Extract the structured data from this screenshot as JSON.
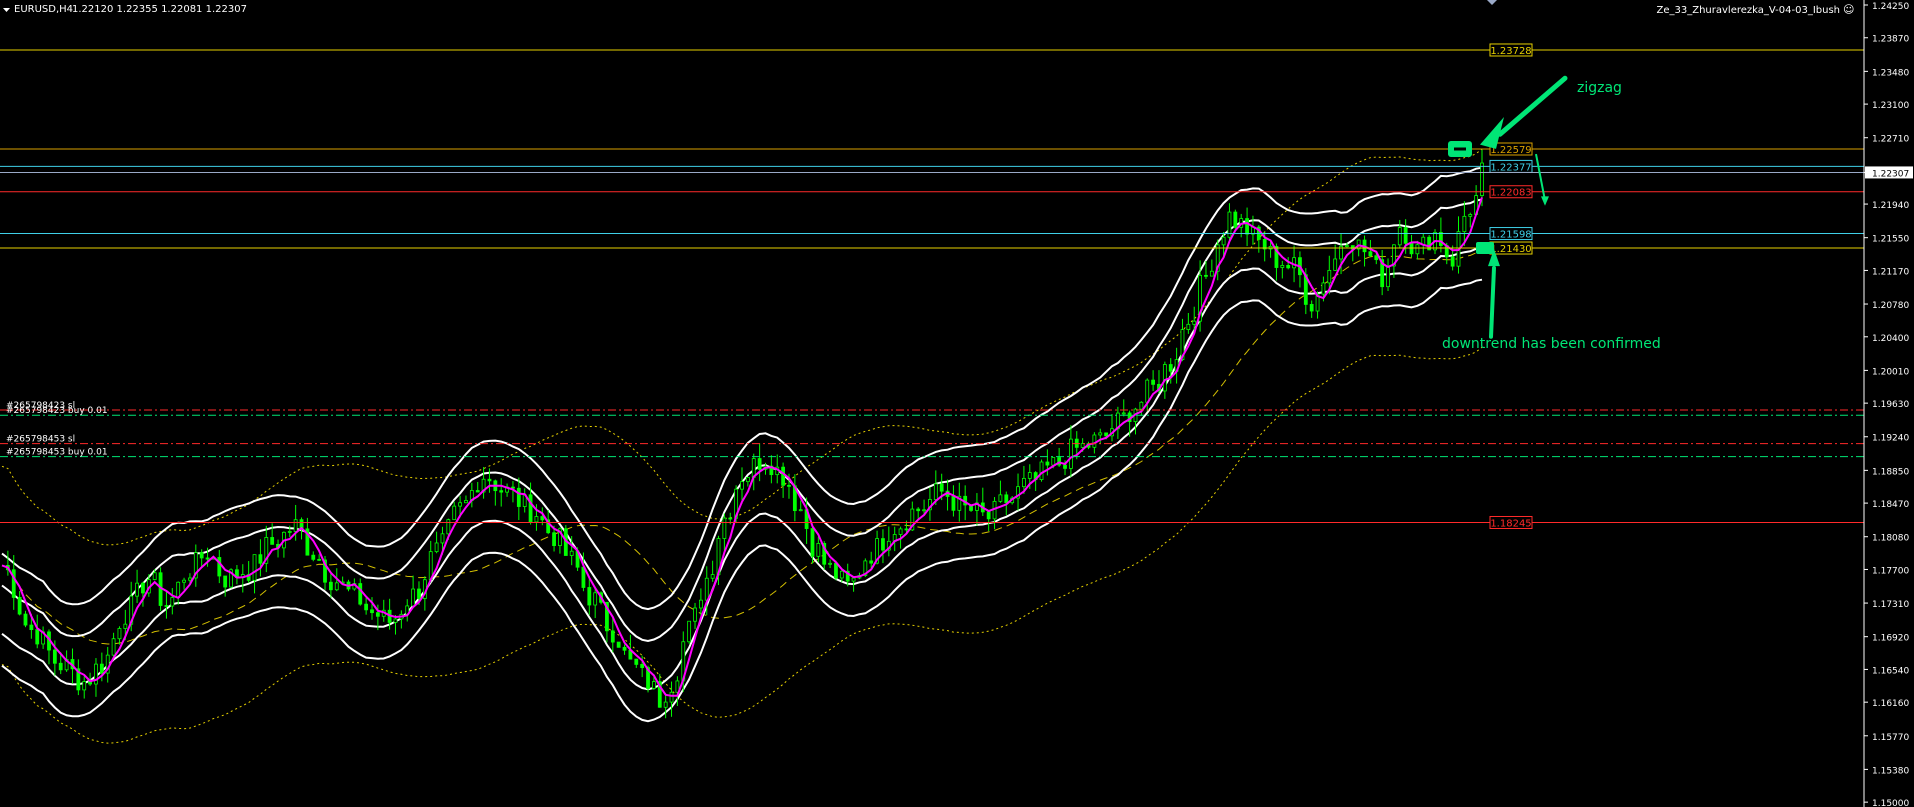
{
  "header": {
    "symbol": "EURUSD,H4",
    "ohlc": "1.22120 1.22355 1.22081 1.22307",
    "indicator_name": "Ze_33_Zhuravlerezka_V-04-03_Ibush",
    "smiley": "☺"
  },
  "colors": {
    "background": "#000000",
    "candle": "#00ff00",
    "band": "#ffffff",
    "ma": "#ff00ff",
    "dotted_band": "#e6d000",
    "dashed_ma": "#d4c000",
    "annotation": "#00e676",
    "axis_text": "#ffffff",
    "grid_text": "#ffffff",
    "orange_line": "#d9a000",
    "yellow_line": "#e6d000",
    "cyan_line": "#3fd0e8",
    "red_line": "#ff2a2a"
  },
  "chart_data": {
    "type": "candlestick",
    "symbol": "EURUSD",
    "timeframe": "H4",
    "ylim": [
      1.1499,
      1.2425
    ],
    "y_ticks": [
      "1.24250",
      "1.23870",
      "1.23480",
      "1.23100",
      "1.22710",
      "1.22307",
      "1.21940",
      "1.21550",
      "1.21170",
      "1.20780",
      "1.20400",
      "1.20010",
      "1.19630",
      "1.19240",
      "1.18850",
      "1.18470",
      "1.18080",
      "1.17700",
      "1.17310",
      "1.16920",
      "1.16540",
      "1.16160",
      "1.15770",
      "1.15380",
      "1.15000"
    ],
    "current_price": "1.22307",
    "path": [
      [
        0,
        1.1775
      ],
      [
        5,
        1.17
      ],
      [
        10,
        1.166
      ],
      [
        14,
        1.164
      ],
      [
        17,
        1.166
      ],
      [
        21,
        1.172
      ],
      [
        25,
        1.176
      ],
      [
        28,
        1.173
      ],
      [
        32,
        1.177
      ],
      [
        35,
        1.179
      ],
      [
        38,
        1.176
      ],
      [
        42,
        1.177
      ],
      [
        46,
        1.18
      ],
      [
        50,
        1.182
      ],
      [
        53,
        1.179
      ],
      [
        56,
        1.176
      ],
      [
        60,
        1.174
      ],
      [
        63,
        1.172
      ],
      [
        66,
        1.171
      ],
      [
        70,
        1.174
      ],
      [
        74,
        1.179
      ],
      [
        78,
        1.184
      ],
      [
        82,
        1.188
      ],
      [
        86,
        1.186
      ],
      [
        90,
        1.184
      ],
      [
        94,
        1.181
      ],
      [
        97,
        1.178
      ],
      [
        100,
        1.174
      ],
      [
        104,
        1.17
      ],
      [
        107,
        1.166
      ],
      [
        110,
        1.164
      ],
      [
        112,
        1.162
      ],
      [
        114,
        1.164
      ],
      [
        117,
        1.17
      ],
      [
        120,
        1.176
      ],
      [
        123,
        1.183
      ],
      [
        126,
        1.188
      ],
      [
        130,
        1.19
      ],
      [
        133,
        1.188
      ],
      [
        136,
        1.184
      ],
      [
        138,
        1.18
      ],
      [
        141,
        1.177
      ],
      [
        144,
        1.175
      ],
      [
        148,
        1.179
      ],
      [
        152,
        1.182
      ],
      [
        156,
        1.184
      ],
      [
        160,
        1.186
      ],
      [
        164,
        1.184
      ],
      [
        168,
        1.183
      ],
      [
        171,
        1.185
      ],
      [
        175,
        1.187
      ],
      [
        179,
        1.189
      ],
      [
        183,
        1.191
      ],
      [
        187,
        1.192
      ],
      [
        190,
        1.194
      ],
      [
        193,
        1.196
      ],
      [
        196,
        1.198
      ],
      [
        199,
        1.201
      ],
      [
        202,
        1.206
      ],
      [
        205,
        1.211
      ],
      [
        207,
        1.215
      ],
      [
        209,
        1.218
      ],
      [
        211,
        1.217
      ],
      [
        214,
        1.215
      ],
      [
        217,
        1.213
      ],
      [
        220,
        1.212
      ],
      [
        223,
        1.208
      ],
      [
        226,
        1.212
      ],
      [
        229,
        1.216
      ],
      [
        232,
        1.214
      ],
      [
        235,
        1.211
      ],
      [
        238,
        1.217
      ],
      [
        241,
        1.214
      ],
      [
        244,
        1.216
      ],
      [
        247,
        1.213
      ],
      [
        249,
        1.218
      ],
      [
        251,
        1.22
      ],
      [
        252,
        1.223
      ]
    ],
    "horizontal_levels": [
      {
        "label": "1.23728",
        "price": 1.23728,
        "color": "yellow_line"
      },
      {
        "label": "1.22579",
        "price": 1.22579,
        "color": "orange_line"
      },
      {
        "label": "1.22377",
        "price": 1.22377,
        "color": "cyan_line"
      },
      {
        "label": "1.22083",
        "price": 1.22083,
        "color": "red_line"
      },
      {
        "label": "1.21598",
        "price": 1.21598,
        "color": "cyan_line"
      },
      {
        "label": "1.21430",
        "price": 1.2143,
        "color": "yellow_line"
      },
      {
        "label": "1.18245",
        "price": 1.18245,
        "color": "red_line"
      }
    ],
    "order_lines": [
      {
        "label": "#265798423 sl",
        "price": 1.1955,
        "color": "red_line"
      },
      {
        "label": "#265798423 buy 0.01",
        "price": 1.1949,
        "color": "annotation"
      },
      {
        "label": "#265798453 sl",
        "price": 1.1916,
        "color": "red_line"
      },
      {
        "label": "#265798453 buy 0.01",
        "price": 1.1901,
        "color": "annotation"
      }
    ]
  },
  "annotations": {
    "zigzag": "zigzag",
    "downtrend": "downtrend has been confirmed"
  }
}
